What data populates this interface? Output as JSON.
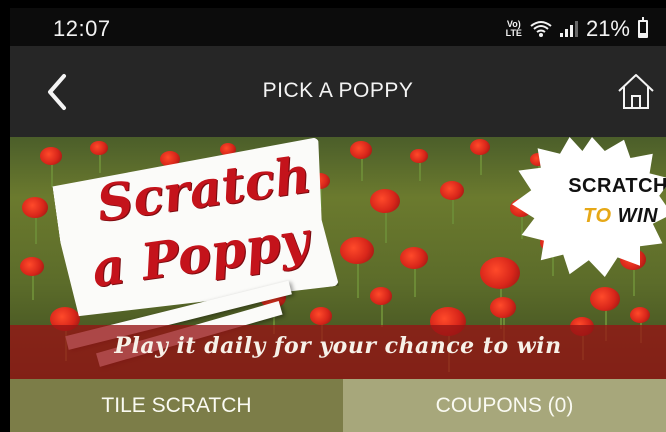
{
  "status_bar": {
    "time": "12:07",
    "network_label": "Vo) LTE",
    "battery": "21%",
    "battery_level": 0.21
  },
  "header": {
    "title": "PICK A POPPY",
    "back_icon": "chevron-left-icon",
    "home_icon": "home-icon"
  },
  "banner": {
    "logo_line1": "Scratch",
    "logo_line2": "a Poppy",
    "badge_line1": "SCRATCH",
    "badge_to": "TO",
    "badge_win": "WIN",
    "tagline": "Play it daily for your chance to win"
  },
  "tabs": [
    {
      "label": "TILE SCRATCH",
      "active": true
    },
    {
      "label": "COUPONS (0)",
      "active": false
    }
  ],
  "colors": {
    "header_bg": "#262626",
    "tab_active": "#7c7d48",
    "tab_inactive": "#a7a77b",
    "brand_red": "#c4131b"
  }
}
